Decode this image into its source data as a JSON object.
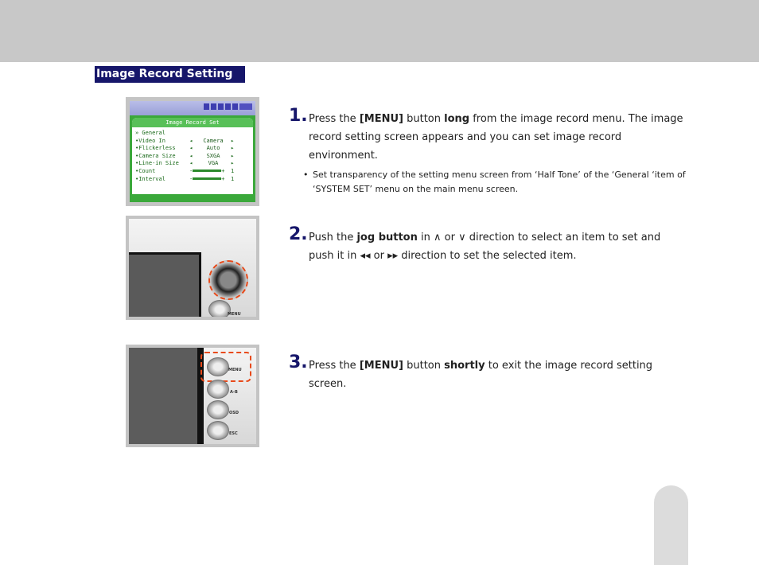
{
  "section_title": "Image Record Setting",
  "figure1": {
    "header": "Image Record Set",
    "group": "» General",
    "rows": [
      {
        "label": "•Video In",
        "value": "Camera"
      },
      {
        "label": "•Flickerless",
        "value": "Auto"
      },
      {
        "label": "•Camera Size",
        "value": "SXGA"
      },
      {
        "label": "•Line-in Size",
        "value": "VGA"
      },
      {
        "label": "•Count",
        "value": "1"
      },
      {
        "label": "•Interval",
        "value": "1"
      }
    ]
  },
  "figure2": {
    "menu_label": "MENU"
  },
  "figure3": {
    "buttons": [
      "MENU",
      "A-B",
      "OSD",
      "ESC"
    ]
  },
  "steps": [
    {
      "number": "1.",
      "t1": "Press the ",
      "b1": "[MENU]",
      "t2": " button ",
      "b2": "long",
      "t3": " from the image record menu. The image record setting screen appears and you can set image record environment.",
      "note": "Set transparency of the setting menu screen from ‘Half Tone’ of the ‘General ‘item of ‘SYSTEM SET’ menu on the main menu screen."
    },
    {
      "number": "2.",
      "t1": "Push the ",
      "b1": "jog button",
      "t2": " in ∧ or ∨ direction to select an item to set and push it in  ◂◂  or  ▸▸  direction to set the selected item."
    },
    {
      "number": "3.",
      "t1": "Press the ",
      "b1": "[MENU]",
      "t2": " button ",
      "b2": "shortly",
      "t3": " to exit the image record setting screen."
    }
  ]
}
